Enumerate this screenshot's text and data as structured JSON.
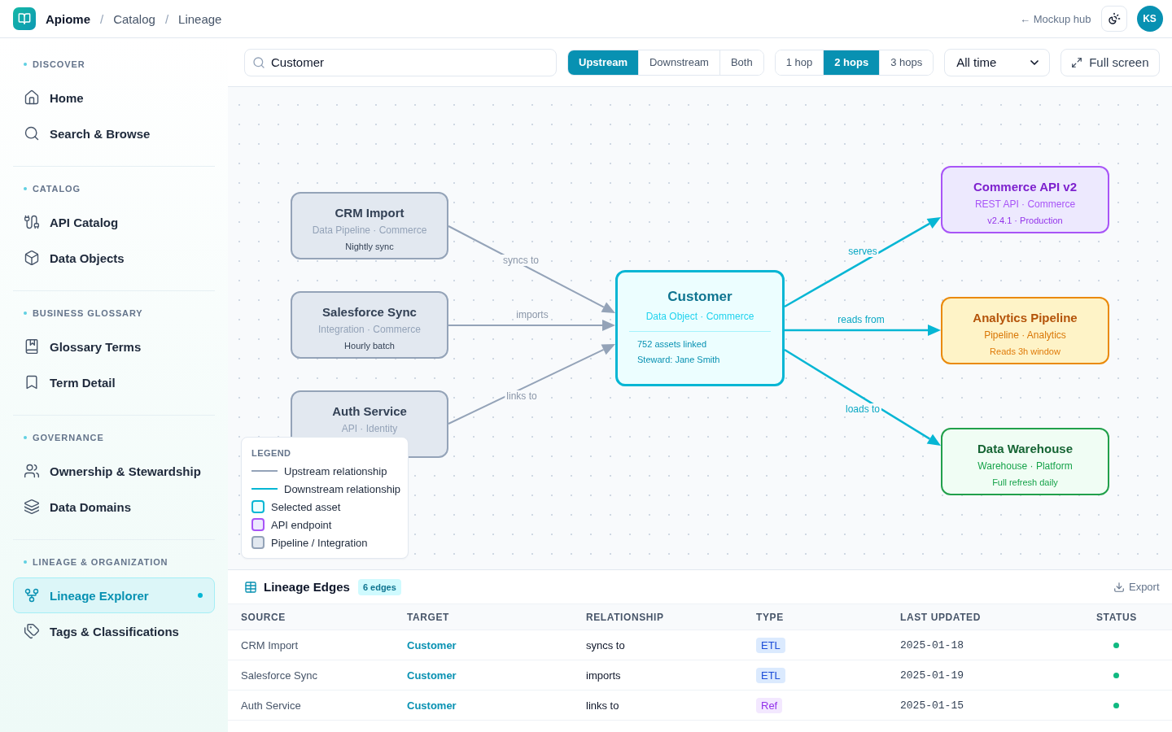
{
  "header": {
    "breadcrumbs": [
      {
        "kind": "brand",
        "label": "Apiome"
      },
      {
        "kind": "separator",
        "label": "/"
      },
      {
        "kind": "link",
        "label": "Catalog"
      },
      {
        "kind": "separator",
        "label": "/"
      },
      {
        "kind": "link",
        "label": "Lineage"
      }
    ],
    "hub_link": "← Mockup hub",
    "avatar": "KS"
  },
  "sidebar": {
    "sections": [
      {
        "label": "DISCOVER",
        "items": [
          {
            "label": "Home",
            "selected": false
          },
          {
            "label": "Search & Browse",
            "selected": false
          }
        ]
      },
      {
        "label": "CATALOG",
        "items": [
          {
            "label": "API Catalog",
            "selected": false
          },
          {
            "label": "Data Objects",
            "selected": false
          }
        ]
      },
      {
        "label": "BUSINESS GLOSSARY",
        "items": [
          {
            "label": "Glossary Terms",
            "selected": false
          },
          {
            "label": "Term Detail",
            "selected": false
          }
        ]
      },
      {
        "label": "GOVERNANCE",
        "items": [
          {
            "label": "Ownership & Stewardship",
            "selected": false
          },
          {
            "label": "Data Domains",
            "selected": false
          }
        ]
      },
      {
        "label": "LINEAGE & ORGANIZATION",
        "items": [
          {
            "label": "Lineage Explorer",
            "selected": true
          },
          {
            "label": "Tags & Classifications",
            "selected": false
          }
        ]
      }
    ]
  },
  "toolbar": {
    "search": {
      "value": "Customer"
    },
    "direction_tabs": [
      {
        "label": "Upstream",
        "selected": true
      },
      {
        "label": "Downstream",
        "selected": false
      },
      {
        "label": "Both",
        "selected": false
      }
    ],
    "hop_tabs": [
      {
        "label": "1 hop",
        "selected": false
      },
      {
        "label": "2 hops",
        "selected": true
      },
      {
        "label": "3 hops",
        "selected": false
      }
    ],
    "time_range": "All time",
    "fullscreen_button": "Full screen"
  },
  "graph": {
    "nodes": [
      {
        "kind": "pipeline",
        "title": "CRM Import",
        "subtitle": "Data Pipeline · Commerce",
        "details": [
          "Nightly sync"
        ]
      },
      {
        "kind": "pipeline",
        "title": "Salesforce Sync",
        "subtitle": "Integration · Commerce",
        "details": [
          "Hourly batch"
        ]
      },
      {
        "kind": "pipeline",
        "title": "Auth Service",
        "subtitle": "API · Identity"
      },
      {
        "kind": "selected",
        "title": "Customer",
        "subtitle": "Data Object · Commerce",
        "details": [
          "752 assets linked",
          "Steward: Jane Smith"
        ]
      },
      {
        "kind": "api",
        "title": "Commerce API v2",
        "subtitle": "REST API · Commerce",
        "details": [
          "v2.4.1 · Production"
        ]
      },
      {
        "kind": "analytics",
        "title": "Analytics Pipeline",
        "subtitle": "Pipeline · Analytics",
        "details": [
          "Reads 3h window"
        ]
      },
      {
        "kind": "warehouse",
        "title": "Data Warehouse",
        "subtitle": "Warehouse · Platform",
        "details": [
          "Full refresh daily"
        ]
      }
    ],
    "edges": [
      {
        "kind": "upstream",
        "label": "syncs to"
      },
      {
        "kind": "upstream",
        "label": "imports"
      },
      {
        "kind": "upstream",
        "label": "links to"
      },
      {
        "kind": "downstream",
        "label": "serves"
      },
      {
        "kind": "downstream",
        "label": "reads from"
      },
      {
        "kind": "downstream",
        "label": "loads to"
      }
    ],
    "legend": {
      "title": "LEGEND",
      "items": [
        {
          "kind": "upstream",
          "label": "Upstream relationship"
        },
        {
          "kind": "downstream",
          "label": "Downstream relationship"
        },
        {
          "kind": "selected",
          "label": "Selected asset"
        },
        {
          "kind": "api",
          "label": "API endpoint"
        },
        {
          "kind": "pipeline",
          "label": "Pipeline / Integration"
        }
      ]
    }
  },
  "table": {
    "title": "Lineage Edges",
    "count_badge": "6 edges",
    "export_button": "Export",
    "columns": [
      "SOURCE",
      "TARGET",
      "RELATIONSHIP",
      "TYPE",
      "LAST UPDATED",
      "STATUS"
    ],
    "rows": [
      {
        "source": "CRM Import",
        "target": "Customer",
        "relationship": "syncs to",
        "type": {
          "kind": "etl",
          "label": "ETL"
        },
        "last_updated": "2025-01-18",
        "color": "#10b981"
      },
      {
        "source": "Salesforce Sync",
        "target": "Customer",
        "relationship": "imports",
        "type": {
          "kind": "etl",
          "label": "ETL"
        },
        "last_updated": "2025-01-19",
        "color": "#10b981"
      },
      {
        "source": "Auth Service",
        "target": "Customer",
        "relationship": "links to",
        "type": {
          "kind": "ref",
          "label": "Ref"
        },
        "last_updated": "2025-01-15",
        "color": "#10b981"
      }
    ]
  }
}
